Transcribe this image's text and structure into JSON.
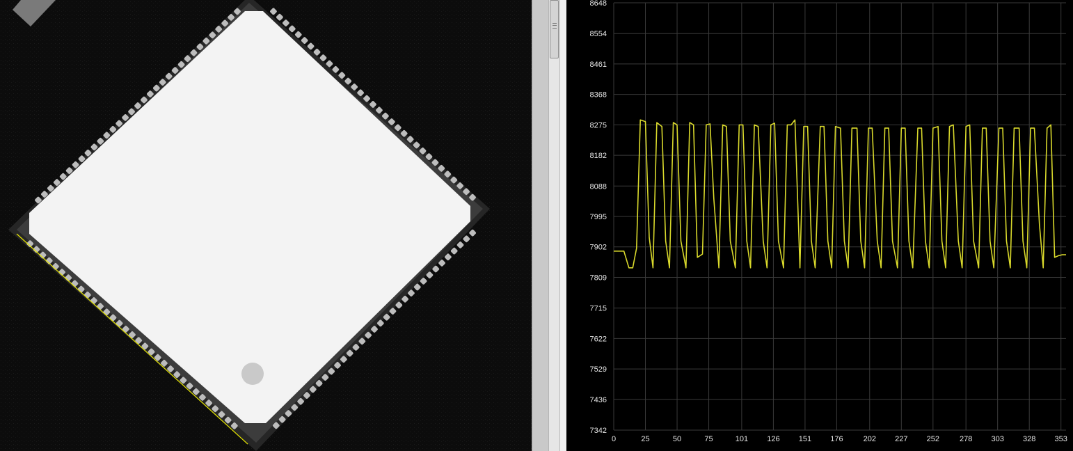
{
  "colors": {
    "plot_background": "#000000",
    "grid": "#3a3a3a",
    "trace": "#d9d92c",
    "profile_line": "#e6e600",
    "tick_text": "#e8e8e8"
  },
  "image_panel": {
    "description_icon": "xray-chip-image"
  },
  "chart_data": {
    "type": "line",
    "title": "",
    "xlabel": "",
    "ylabel": "",
    "xlim": [
      0,
      357
    ],
    "ylim": [
      7342,
      8648
    ],
    "x_ticks": [
      "0",
      "25",
      "50",
      "75",
      "101",
      "126",
      "151",
      "176",
      "202",
      "227",
      "252",
      "278",
      "303",
      "328",
      "353"
    ],
    "y_ticks": [
      "8648",
      "8554",
      "8461",
      "8368",
      "8275",
      "8182",
      "8088",
      "7995",
      "7902",
      "7809",
      "7715",
      "7622",
      "7529",
      "7436",
      "7342"
    ],
    "grid": true,
    "series": [
      {
        "x": [
          0,
          8,
          12,
          15,
          18,
          21,
          25,
          28,
          31,
          34,
          38,
          41,
          44,
          47,
          50,
          53,
          57,
          60,
          63,
          66,
          70,
          73,
          76,
          79,
          83,
          86,
          89,
          92,
          96,
          99,
          102,
          105,
          108,
          111,
          114,
          118,
          121,
          124,
          127,
          130,
          134,
          137,
          140,
          143,
          147,
          150,
          153,
          156,
          159,
          163,
          166,
          169,
          172,
          175,
          179,
          182,
          185,
          188,
          192,
          195,
          198,
          201,
          204,
          208,
          211,
          214,
          217,
          220,
          224,
          227,
          230,
          233,
          236,
          240,
          243,
          246,
          249,
          252,
          256,
          259,
          262,
          265,
          268,
          272,
          275,
          278,
          281,
          284,
          288,
          291,
          294,
          297,
          300,
          304,
          307,
          310,
          313,
          316,
          320,
          323,
          326,
          329,
          332,
          336,
          339,
          342,
          345,
          348,
          351,
          354,
          357
        ],
        "y": [
          7889,
          7889,
          7838,
          7838,
          7898,
          8290,
          8285,
          7931,
          7838,
          8282,
          8270,
          7920,
          7838,
          8282,
          8275,
          7920,
          7838,
          8282,
          8275,
          7870,
          7880,
          8275,
          8278,
          8050,
          7838,
          8275,
          8270,
          7920,
          7838,
          8275,
          8275,
          7920,
          7838,
          8275,
          8270,
          7920,
          7838,
          8275,
          8280,
          7920,
          7838,
          8275,
          8275,
          8290,
          7838,
          8270,
          8270,
          7920,
          7838,
          8270,
          8270,
          7920,
          7838,
          8270,
          8265,
          7920,
          7838,
          8265,
          8265,
          7920,
          7838,
          8265,
          8265,
          7920,
          7838,
          8265,
          8265,
          7920,
          7838,
          8265,
          8265,
          7920,
          7838,
          8265,
          8265,
          7920,
          7838,
          8265,
          8270,
          7920,
          7838,
          8270,
          8275,
          7920,
          7838,
          8270,
          8275,
          7920,
          7838,
          8265,
          8265,
          7920,
          7838,
          8265,
          8265,
          7920,
          7838,
          8265,
          8265,
          7920,
          7838,
          8265,
          8265,
          7970,
          7838,
          8265,
          8275,
          7870,
          7875,
          7878,
          7878
        ]
      }
    ]
  }
}
